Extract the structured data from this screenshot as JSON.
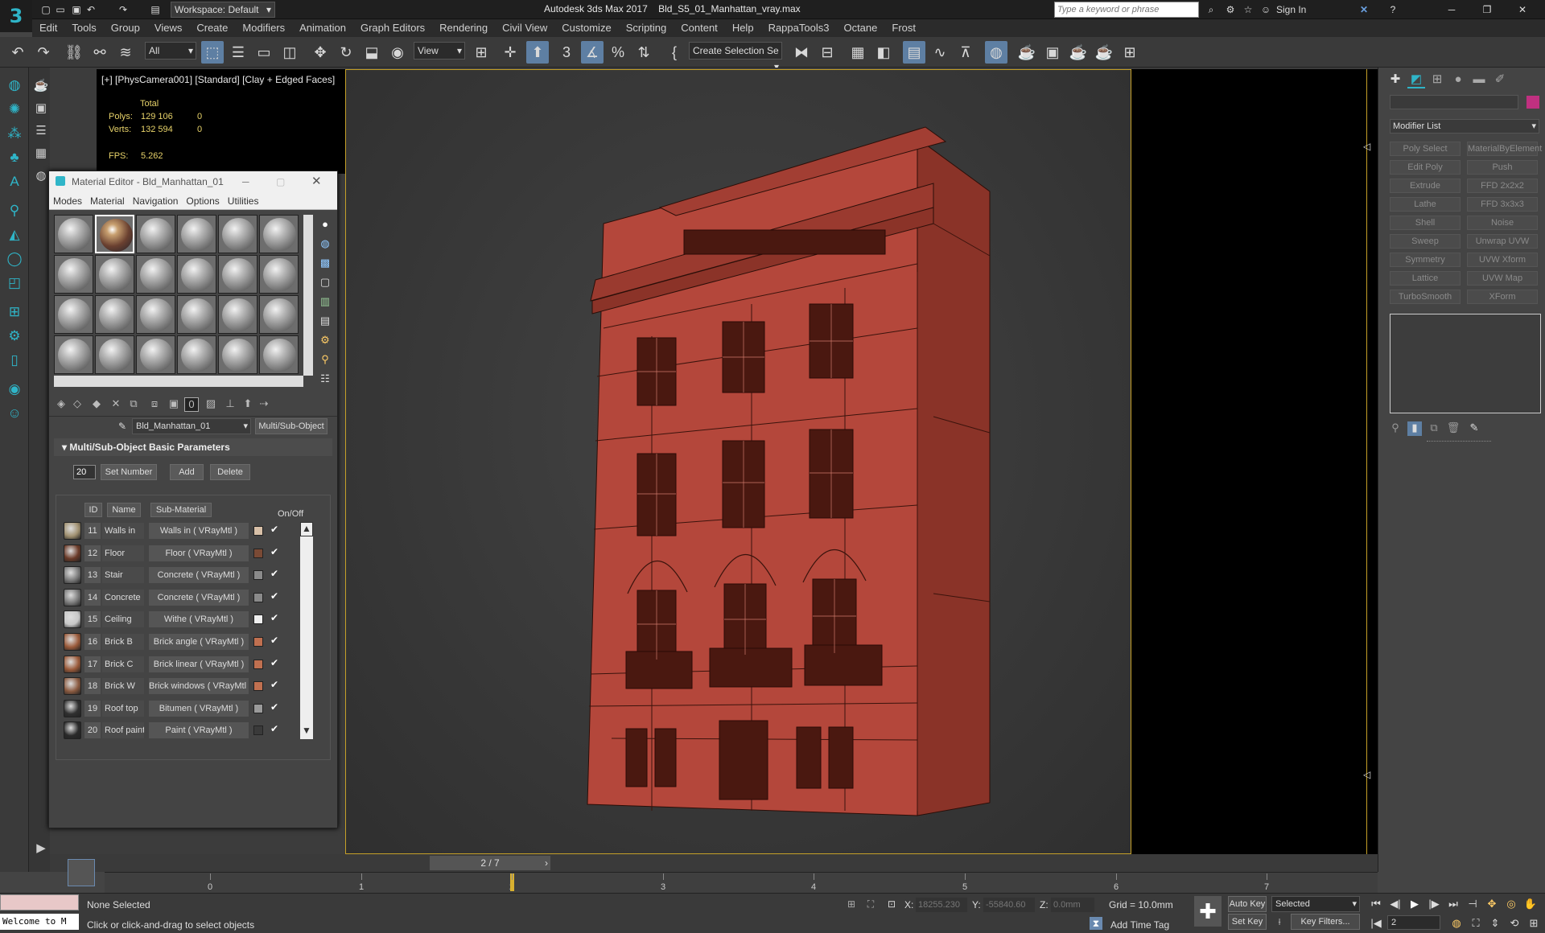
{
  "title_bar": {
    "workspace_label": "Workspace: Default",
    "app_title": "Autodesk 3ds Max 2017",
    "file_name": "Bld_S5_01_Manhattan_vray.max",
    "search_placeholder": "Type a keyword or phrase",
    "sign_in": "Sign In"
  },
  "menu": [
    "Edit",
    "Tools",
    "Group",
    "Views",
    "Create",
    "Modifiers",
    "Animation",
    "Graph Editors",
    "Rendering",
    "Civil View",
    "Customize",
    "Scripting",
    "Content",
    "Help",
    "RappaTools3",
    "Octane",
    "Frost"
  ],
  "toolbar": {
    "selection_filter": "All",
    "ref_coord": "View",
    "named_selection": "Create Selection Se"
  },
  "viewport": {
    "label": "[+] [PhysCamera001] [Standard] [Clay + Edged Faces]",
    "stats_total": "Total",
    "polys_label": "Polys:",
    "polys_value": "129 106",
    "polys_sel": "0",
    "verts_label": "Verts:",
    "verts_value": "132 594",
    "verts_sel": "0",
    "fps_label": "FPS:",
    "fps_value": "5.262"
  },
  "material_editor": {
    "title": "Material Editor - Bld_Manhattan_01",
    "menu": [
      "Modes",
      "Material",
      "Navigation",
      "Options",
      "Utilities"
    ],
    "material_name": "Bld_Manhattan_01",
    "material_type": "Multi/Sub-Object",
    "rollout": "Multi/Sub-Object Basic Parameters",
    "number": "20",
    "set_number": "Set Number",
    "add": "Add",
    "delete": "Delete",
    "col_id": "ID",
    "col_name": "Name",
    "col_sub": "Sub-Material",
    "col_onoff": "On/Off",
    "rows": [
      {
        "id": "11",
        "name": "Walls in",
        "sub": "Walls in  ( VRayMtl )",
        "color": "#d8c0a8",
        "swatch": "#a09070"
      },
      {
        "id": "12",
        "name": "Floor",
        "sub": "Floor  ( VRayMtl )",
        "color": "#7a4a35",
        "swatch": "#6a3a28"
      },
      {
        "id": "13",
        "name": "Stair",
        "sub": "Concrete  ( VRayMtl )",
        "color": "#8a8a8a",
        "swatch": "#7a7a7a"
      },
      {
        "id": "14",
        "name": "Concrete",
        "sub": "Concrete  ( VRayMtl )",
        "color": "#8a8a8a",
        "swatch": "#7a7a7a"
      },
      {
        "id": "15",
        "name": "Ceiling",
        "sub": "Withe  ( VRayMtl )",
        "color": "#f0f0f0",
        "swatch": "#c8c8c8"
      },
      {
        "id": "16",
        "name": "Brick B",
        "sub": "Brick angle  ( VRayMtl )",
        "color": "#c07050",
        "swatch": "#9a5a3a"
      },
      {
        "id": "17",
        "name": "Brick C",
        "sub": "Brick linear  ( VRayMtl )",
        "color": "#c07050",
        "swatch": "#9a5a3a"
      },
      {
        "id": "18",
        "name": "Brick W",
        "sub": "Brick windows  ( VRayMtl )",
        "color": "#c07050",
        "swatch": "#8a5a40"
      },
      {
        "id": "19",
        "name": "Roof top",
        "sub": "Bitumen  ( VRayMtl )",
        "color": "#9a9a9a",
        "swatch": "#303030"
      },
      {
        "id": "20",
        "name": "Roof paint",
        "sub": "Paint  ( VRayMtl )",
        "color": "#3a3a3a",
        "swatch": "#2a2a2a"
      }
    ]
  },
  "command_panel": {
    "modifier_list": "Modifier List",
    "modifiers": [
      "Poly Select",
      "MaterialByElement",
      "Edit Poly",
      "Push",
      "Extrude",
      "FFD 2x2x2",
      "Lathe",
      "FFD 3x3x3",
      "Shell",
      "Noise",
      "Sweep",
      "Unwrap UVW",
      "Symmetry",
      "UVW Xform",
      "Lattice",
      "UVW Map",
      "TurboSmooth",
      "XForm"
    ]
  },
  "timeline": {
    "frame": "2 / 7",
    "ticks": [
      "0",
      "1",
      "2",
      "3",
      "4",
      "5",
      "6",
      "7"
    ]
  },
  "status": {
    "listener": "Welcome to M",
    "selection": "None Selected",
    "prompt": "Click or click-and-drag to select objects",
    "x_label": "X:",
    "x_value": "18255.230",
    "y_label": "Y:",
    "y_value": "-55840.60",
    "z_label": "Z:",
    "z_value": "0.0mm",
    "grid": "Grid = 10.0mm",
    "add_time_tag": "Add Time Tag",
    "auto_key": "Auto Key",
    "set_key": "Set Key",
    "selected": "Selected",
    "key_filters": "Key Filters...",
    "frame_field": "2"
  }
}
